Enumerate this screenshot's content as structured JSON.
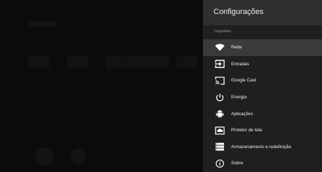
{
  "settings": {
    "title": "Configurações",
    "section": "Dispositivo",
    "items": [
      {
        "label": "Rede",
        "icon": "wifi-icon",
        "selected": true
      },
      {
        "label": "Entradas",
        "icon": "input-icon",
        "selected": false
      },
      {
        "label": "Google Cast",
        "icon": "cast-icon",
        "selected": false
      },
      {
        "label": "Energia",
        "icon": "power-icon",
        "selected": false
      },
      {
        "label": "Aplicações",
        "icon": "android-icon",
        "selected": false
      },
      {
        "label": "Protetor de tela",
        "icon": "screensaver-icon",
        "selected": false
      },
      {
        "label": "Armazenamento e redefinição",
        "icon": "storage-icon",
        "selected": false
      },
      {
        "label": "Sobre",
        "icon": "info-icon",
        "selected": false
      }
    ]
  }
}
